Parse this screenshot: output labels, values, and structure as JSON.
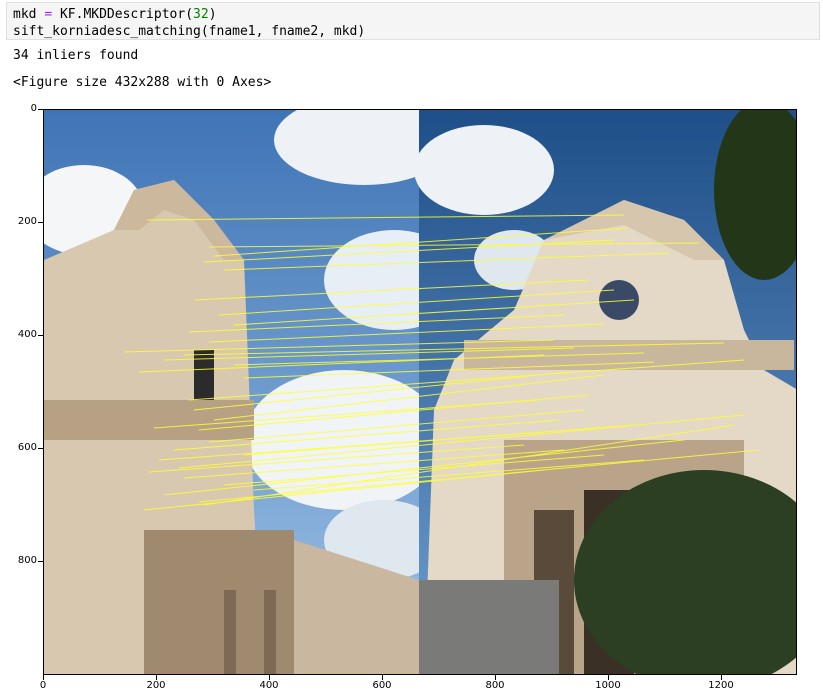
{
  "notebook": {
    "code_line1_prefix": "mkd ",
    "code_line1_op": "=",
    "code_line1_mid": " KF.MKDDescriptor(",
    "code_line1_num": "32",
    "code_line1_end": ")",
    "code_line2": "sift_korniadesc_matching(fname1, fname2, mkd)",
    "output_inliers": "34 inliers found",
    "output_figure": "<Figure size 432x288 with 0 Axes>"
  },
  "figure": {
    "y_ticks": [
      "0",
      "200",
      "400",
      "600",
      "800"
    ],
    "x_ticks": [
      "0",
      "200",
      "400",
      "600",
      "800",
      "1000",
      "1200"
    ],
    "line_color": "#ffff33",
    "matches_count": 34
  }
}
